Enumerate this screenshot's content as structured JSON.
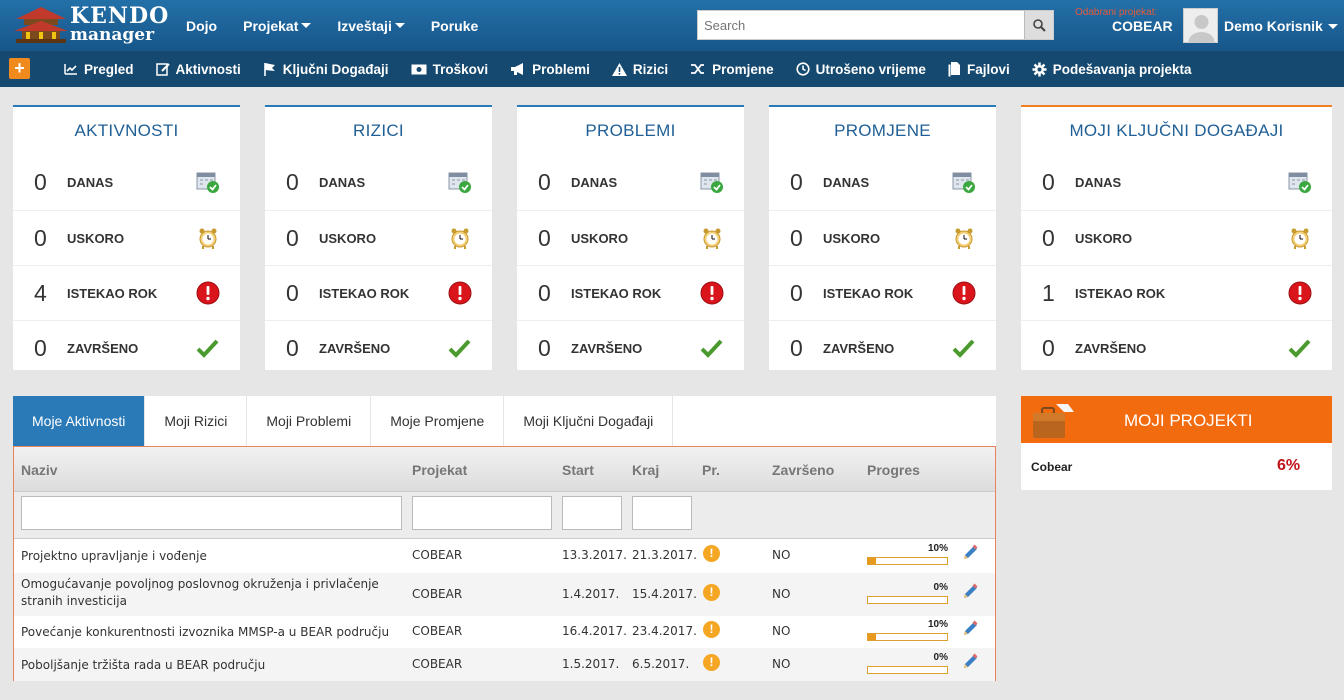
{
  "app": {
    "logo_line1": "KENDO",
    "logo_line2": "manager"
  },
  "topnav": {
    "items": [
      {
        "label": "Dojo",
        "dropdown": false
      },
      {
        "label": "Projekat",
        "dropdown": true
      },
      {
        "label": "Izveštaji",
        "dropdown": true
      },
      {
        "label": "Poruke",
        "dropdown": false
      }
    ],
    "search_placeholder": "Search",
    "selected_project_label": "Odabrani projekat:",
    "selected_project": "COBEAR",
    "user_name": "Demo Korisnik"
  },
  "subnav": {
    "add_label": "+",
    "items": [
      {
        "label": "Pregled",
        "icon": "chart-icon"
      },
      {
        "label": "Aktivnosti",
        "icon": "edit-doc-icon"
      },
      {
        "label": "Ključni Događaji",
        "icon": "flag-icon"
      },
      {
        "label": "Troškovi",
        "icon": "money-icon"
      },
      {
        "label": "Problemi",
        "icon": "megaphone-icon"
      },
      {
        "label": "Rizici",
        "icon": "warning-icon"
      },
      {
        "label": "Promjene",
        "icon": "shuffle-icon"
      },
      {
        "label": "Utrošeno vrijeme",
        "icon": "clock-icon"
      },
      {
        "label": "Fajlovi",
        "icon": "files-icon"
      },
      {
        "label": "Podešavanja projekta",
        "icon": "gear-icon"
      }
    ]
  },
  "cards": [
    {
      "title": "AKTIVNOSTI",
      "rows": [
        {
          "count": "0",
          "label": "DANAS"
        },
        {
          "count": "0",
          "label": "USKORO"
        },
        {
          "count": "4",
          "label": "ISTEKAO ROK"
        },
        {
          "count": "0",
          "label": "ZAVRŠENO"
        }
      ]
    },
    {
      "title": "RIZICI",
      "rows": [
        {
          "count": "0",
          "label": "DANAS"
        },
        {
          "count": "0",
          "label": "USKORO"
        },
        {
          "count": "0",
          "label": "ISTEKAO ROK"
        },
        {
          "count": "0",
          "label": "ZAVRŠENO"
        }
      ]
    },
    {
      "title": "PROBLEMI",
      "rows": [
        {
          "count": "0",
          "label": "DANAS"
        },
        {
          "count": "0",
          "label": "USKORO"
        },
        {
          "count": "0",
          "label": "ISTEKAO ROK"
        },
        {
          "count": "0",
          "label": "ZAVRŠENO"
        }
      ]
    },
    {
      "title": "PROMJENE",
      "rows": [
        {
          "count": "0",
          "label": "DANAS"
        },
        {
          "count": "0",
          "label": "USKORO"
        },
        {
          "count": "0",
          "label": "ISTEKAO ROK"
        },
        {
          "count": "0",
          "label": "ZAVRŠENO"
        }
      ]
    },
    {
      "title": "MOJI KLJUČNI DOGAĐAJI",
      "rows": [
        {
          "count": "0",
          "label": "DANAS"
        },
        {
          "count": "0",
          "label": "USKORO"
        },
        {
          "count": "1",
          "label": "ISTEKAO ROK"
        },
        {
          "count": "0",
          "label": "ZAVRŠENO"
        }
      ]
    }
  ],
  "tabs": [
    {
      "label": "Moje Aktivnosti",
      "active": true
    },
    {
      "label": "Moji Rizici",
      "active": false
    },
    {
      "label": "Moji Problemi",
      "active": false
    },
    {
      "label": "Moje Promjene",
      "active": false
    },
    {
      "label": "Moji Ključni Događaji",
      "active": false
    }
  ],
  "grid": {
    "columns": [
      "Naziv",
      "Projekat",
      "Start",
      "Kraj",
      "Pr.",
      "Završeno",
      "Progres"
    ],
    "rows": [
      {
        "name": "Projektno upravljanje i vođenje",
        "project": "COBEAR",
        "start": "13.3.2017.",
        "end": "21.3.2017.",
        "priority": "!",
        "done": "NO",
        "progress_label": "10%",
        "progress": 0.1
      },
      {
        "name": "Omogućavanje povoljnog poslovnog okruženja i privlačenje stranih investicija",
        "project": "COBEAR",
        "start": "1.4.2017.",
        "end": "15.4.2017.",
        "priority": "!",
        "done": "NO",
        "progress_label": "0%",
        "progress": 0
      },
      {
        "name": "Povećanje konkurentnosti izvoznika MMSP-a u BEAR području",
        "project": "COBEAR",
        "start": "16.4.2017.",
        "end": "23.4.2017.",
        "priority": "!",
        "done": "NO",
        "progress_label": "10%",
        "progress": 0.1
      },
      {
        "name": "Poboljšanje tržišta rada u BEAR području",
        "project": "COBEAR",
        "start": "1.5.2017.",
        "end": "6.5.2017.",
        "priority": "!",
        "done": "NO",
        "progress_label": "0%",
        "progress": 0
      }
    ]
  },
  "my_projects": {
    "title": "MOJI PROJEKTI",
    "items": [
      {
        "name": "Cobear",
        "percent": "6%"
      }
    ]
  }
}
